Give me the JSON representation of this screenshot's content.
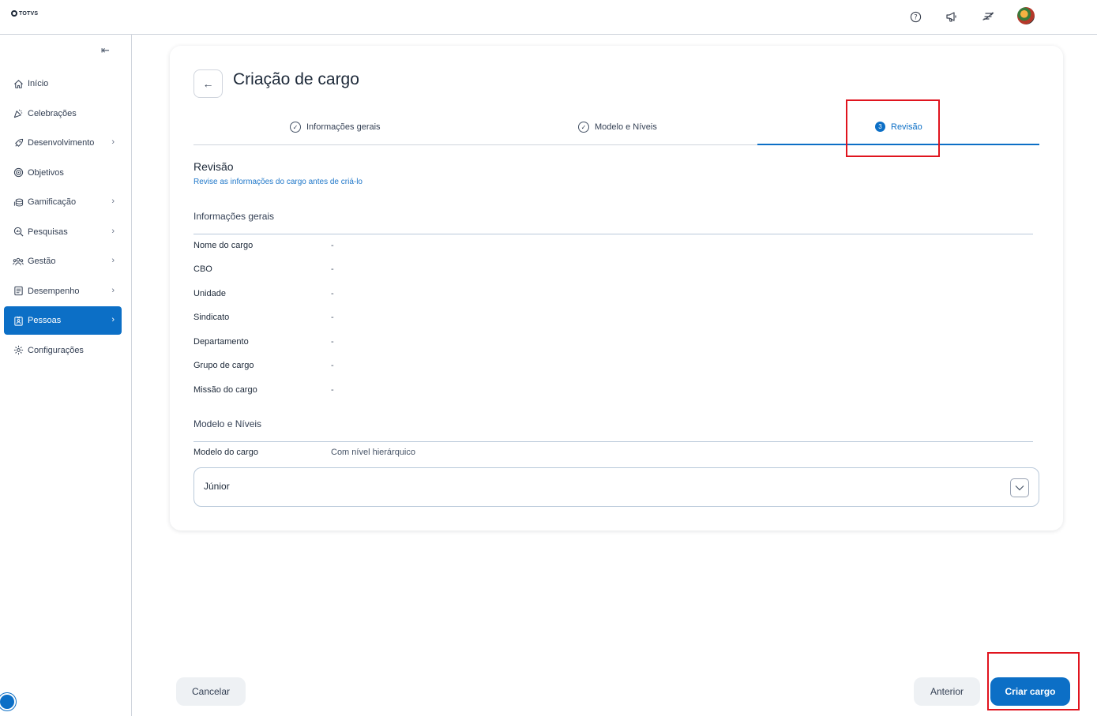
{
  "header": {
    "logo_text": "TOTVS",
    "icons": [
      "help-icon",
      "megaphone-icon",
      "shortcut-icon",
      "bell-icon"
    ]
  },
  "sidebar": {
    "collapse_icon": "collapse-arrow-icon",
    "items": [
      {
        "label": "Início",
        "icon": "home-icon",
        "has_children": false,
        "active": false
      },
      {
        "label": "Celebrações",
        "icon": "party-icon",
        "has_children": false,
        "active": false
      },
      {
        "label": "Desenvolvimento",
        "icon": "rocket-icon",
        "has_children": true,
        "active": false
      },
      {
        "label": "Objetivos",
        "icon": "target-icon",
        "has_children": false,
        "active": false
      },
      {
        "label": "Gamificação",
        "icon": "coins-icon",
        "has_children": true,
        "active": false
      },
      {
        "label": "Pesquisas",
        "icon": "search-chart-icon",
        "has_children": true,
        "active": false
      },
      {
        "label": "Gestão",
        "icon": "team-icon",
        "has_children": true,
        "active": false
      },
      {
        "label": "Desempenho",
        "icon": "checklist-icon",
        "has_children": true,
        "active": false
      },
      {
        "label": "Pessoas",
        "icon": "badge-icon",
        "has_children": true,
        "active": true
      },
      {
        "label": "Configurações",
        "icon": "gear-icon",
        "has_children": false,
        "active": false
      }
    ]
  },
  "page": {
    "title": "Criação de cargo",
    "steps": [
      {
        "label": "Informações gerais",
        "status": "done"
      },
      {
        "label": "Modelo e Níveis",
        "status": "done"
      },
      {
        "label": "Revisão",
        "status": "current",
        "number": "3"
      }
    ],
    "section_title": "Revisão",
    "section_subtitle": "Revise as informações do cargo antes de criá-lo",
    "general_info": {
      "title": "Informações gerais",
      "rows": [
        {
          "label": "Nome do cargo",
          "value": "-"
        },
        {
          "label": "CBO",
          "value": "-"
        },
        {
          "label": "Unidade",
          "value": "-"
        },
        {
          "label": "Sindicato",
          "value": "-"
        },
        {
          "label": "Departamento",
          "value": "-"
        },
        {
          "label": "Grupo de cargo",
          "value": "-"
        },
        {
          "label": "Missão do cargo",
          "value": "-"
        }
      ]
    },
    "model_levels": {
      "title": "Modelo e Níveis",
      "model_label": "Modelo do cargo",
      "model_value": "Com nível hierárquico",
      "accordion_label": "Júnior"
    }
  },
  "footer": {
    "cancel_label": "Cancelar",
    "previous_label": "Anterior",
    "create_label": "Criar cargo"
  },
  "colors": {
    "accent": "#0c6fc6",
    "highlight": "#e0141e"
  }
}
